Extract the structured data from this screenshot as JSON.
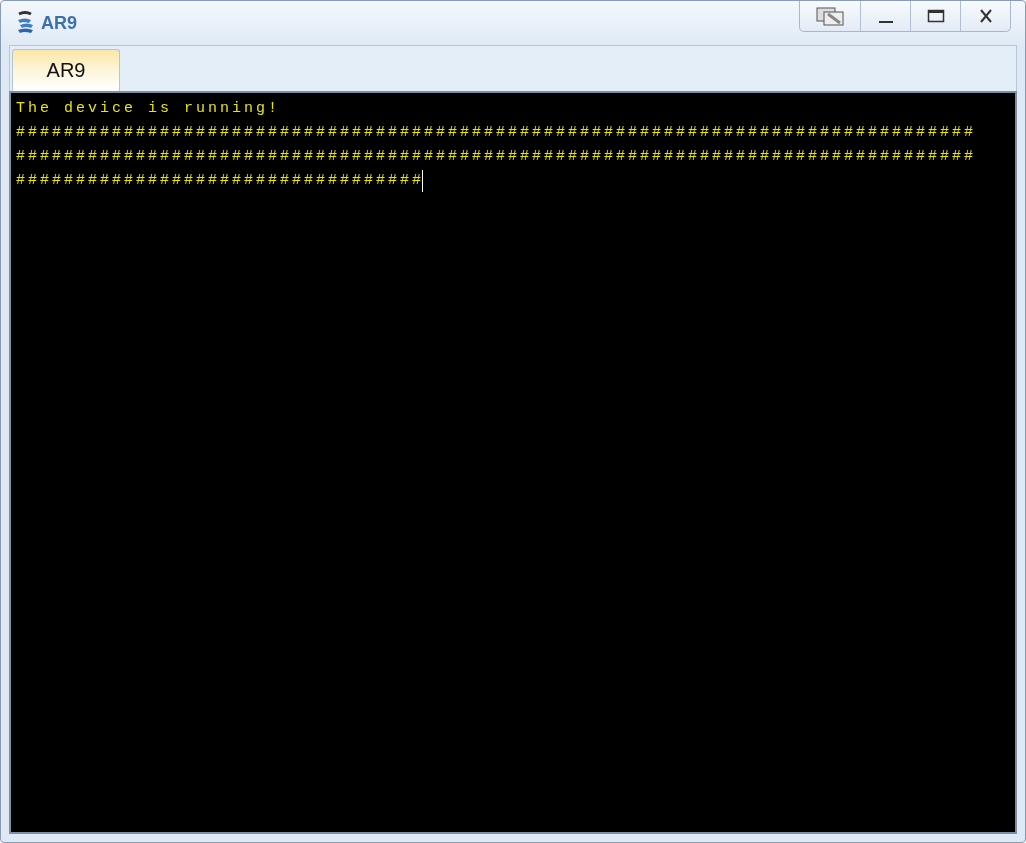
{
  "window": {
    "title": "AR9"
  },
  "tabs": [
    {
      "label": "AR9",
      "selected": true
    }
  ],
  "terminal": {
    "lines": [
      "The device is running!",
      "################################################################################",
      "################################################################################",
      "##################################"
    ],
    "cursor": true
  }
}
